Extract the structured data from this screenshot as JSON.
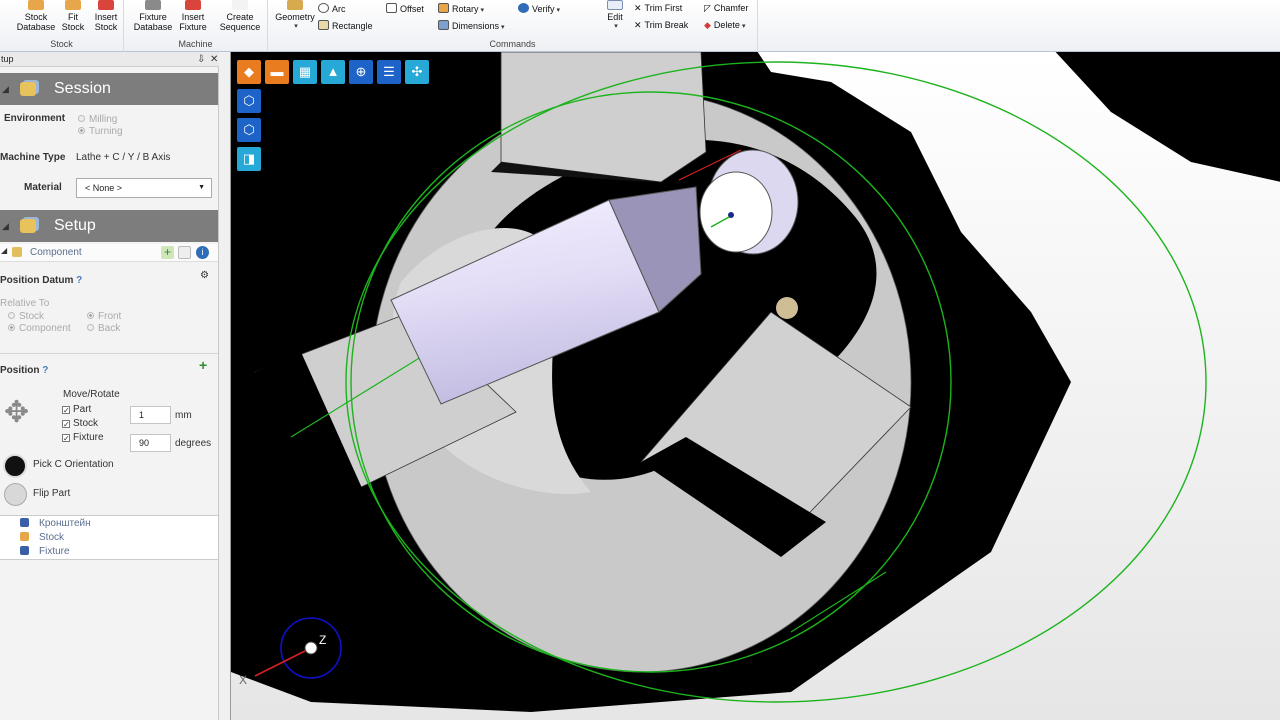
{
  "ribbon": {
    "stock_group": {
      "label": "Stock",
      "stock_database": "Stock\nDatabase",
      "fit_stock": "Fit\nStock",
      "insert_stock": "Insert\nStock"
    },
    "machine_group": {
      "label": "Machine",
      "fixture_database": "Fixture\nDatabase",
      "insert_fixture": "Insert\nFixture",
      "create_sequence": "Create\nSequence"
    },
    "commands_group": {
      "label": "Commands",
      "geometry": "Geometry",
      "arc": "Arc",
      "rectangle": "Rectangle",
      "offset": "Offset",
      "rotary": "Rotary",
      "dimensions": "Dimensions",
      "verify": "Verify",
      "edit": "Edit",
      "trim_first": "Trim First",
      "trim_break": "Trim Break",
      "chamfer": "Chamfer",
      "delete": "Delete"
    }
  },
  "panel": {
    "title": "tup",
    "pin_icon": "pin-icon",
    "close_icon": "close-icon",
    "session": {
      "header": "Session",
      "environment_label": "Environment",
      "env_options": [
        "Milling",
        "Turning"
      ],
      "machine_type_label": "Machine Type",
      "machine_type_value": "Lathe + C / Y / B Axis",
      "material_label": "Material",
      "material_value": "< None >"
    },
    "setup": {
      "header": "Setup",
      "component_label": "Component",
      "position_datum_label": "Position Datum",
      "relative_to_label": "Relative To",
      "relative_options": [
        "Stock",
        "Component",
        "Front",
        "Back"
      ],
      "position_label": "Position",
      "move_rotate_label": "Move/Rotate",
      "checks": [
        "Part",
        "Stock",
        "Fixture"
      ],
      "move_value": "1",
      "move_unit": "mm",
      "rotate_value": "90",
      "rotate_unit": "degrees",
      "pick_c_orientation": "Pick C Orientation",
      "flip_part": "Flip Part"
    },
    "tree": [
      "Кронштейн",
      "Stock",
      "Fixture"
    ]
  },
  "viewport": {
    "axis_labels": {
      "z": "Z",
      "x": "X"
    },
    "toolbar_icons": [
      "view-iso-icon",
      "view-machine-icon",
      "view-setup-icon",
      "view-light-icon",
      "zoom-icon",
      "list-icon",
      "grid-icon",
      "view-front-icon",
      "view-side-icon",
      "view-top-icon"
    ],
    "colors": {
      "toolbar_orange": "#e87c1e",
      "toolbar_blue": "#1e88e5",
      "toolbar_cyan": "#26a9d6",
      "guide_green": "#1db31d"
    }
  }
}
